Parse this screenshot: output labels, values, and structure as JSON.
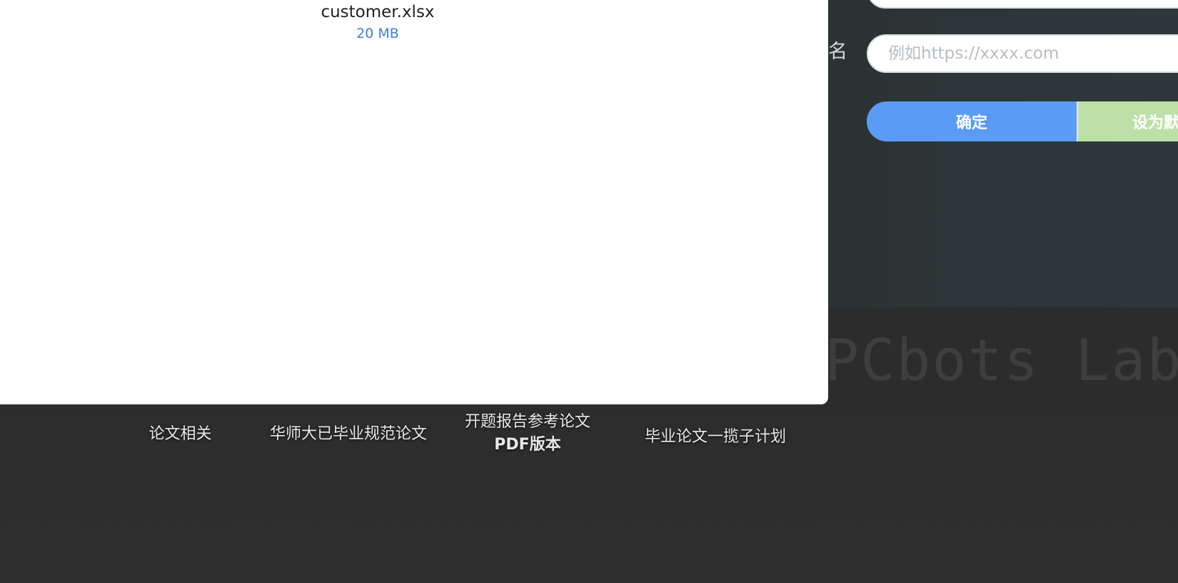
{
  "file": {
    "name": "customer.xlsx",
    "size": "20 MB"
  },
  "settings": {
    "field_label": "名",
    "url_placeholder": "例如https://xxxx.com",
    "confirm_label": "确定",
    "set_default_label": "设为默"
  },
  "brand": {
    "text": "PCbots Lab's"
  },
  "footer": {
    "links": [
      {
        "label": "论文相关"
      },
      {
        "label": "华师大已毕业规范论文"
      },
      {
        "label_line1": "开题报告参考论文",
        "label_line2": "PDF版本"
      },
      {
        "label": "毕业论文一揽子计划"
      }
    ]
  },
  "colors": {
    "confirm_button": "#5a9cf5",
    "default_button": "#bde0a8",
    "file_size": "#3f7fd6",
    "page_background": "#2d2d2d",
    "panel_background": "#2c3537"
  }
}
